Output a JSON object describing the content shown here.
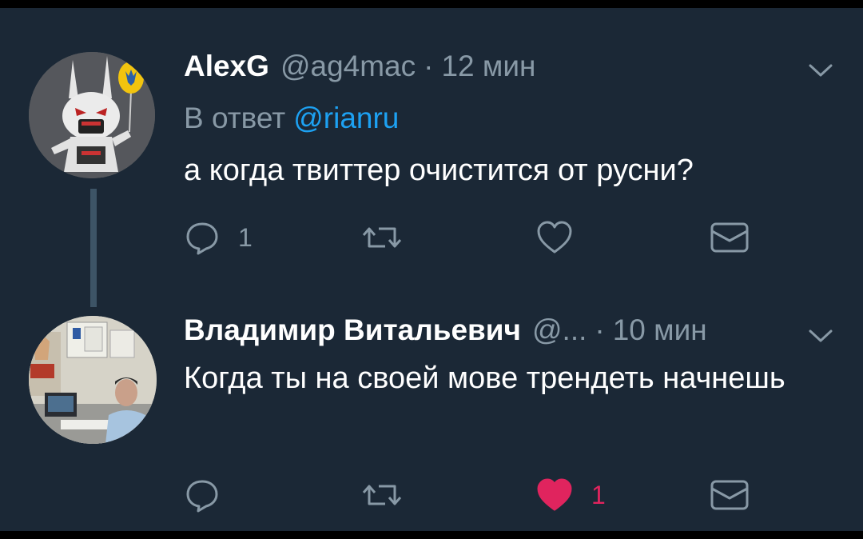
{
  "tweets": [
    {
      "name": "AlexG",
      "handle": "@ag4mac",
      "separator": "·",
      "time": "12 мин",
      "reply_prefix": "В ответ",
      "reply_handle": "@rianru",
      "text": "а когда твиттер очистится от русни?",
      "reply_count": "1",
      "like_count": "",
      "liked": false
    },
    {
      "name": "Владимир Витальевич",
      "handle": "@...",
      "separator": "·",
      "time": "10 мин",
      "text": "Когда ты на своей мове трендеть начнешь",
      "reply_count": "",
      "like_count": "1",
      "liked": true
    }
  ],
  "colors": {
    "background": "#1b2836",
    "text": "#ffffff",
    "secondary": "#8899a6",
    "link": "#1da1f2",
    "like": "#e0245e"
  },
  "icons": [
    "reply-icon",
    "retweet-icon",
    "like-icon",
    "direct-message-icon",
    "chevron-down-icon"
  ]
}
